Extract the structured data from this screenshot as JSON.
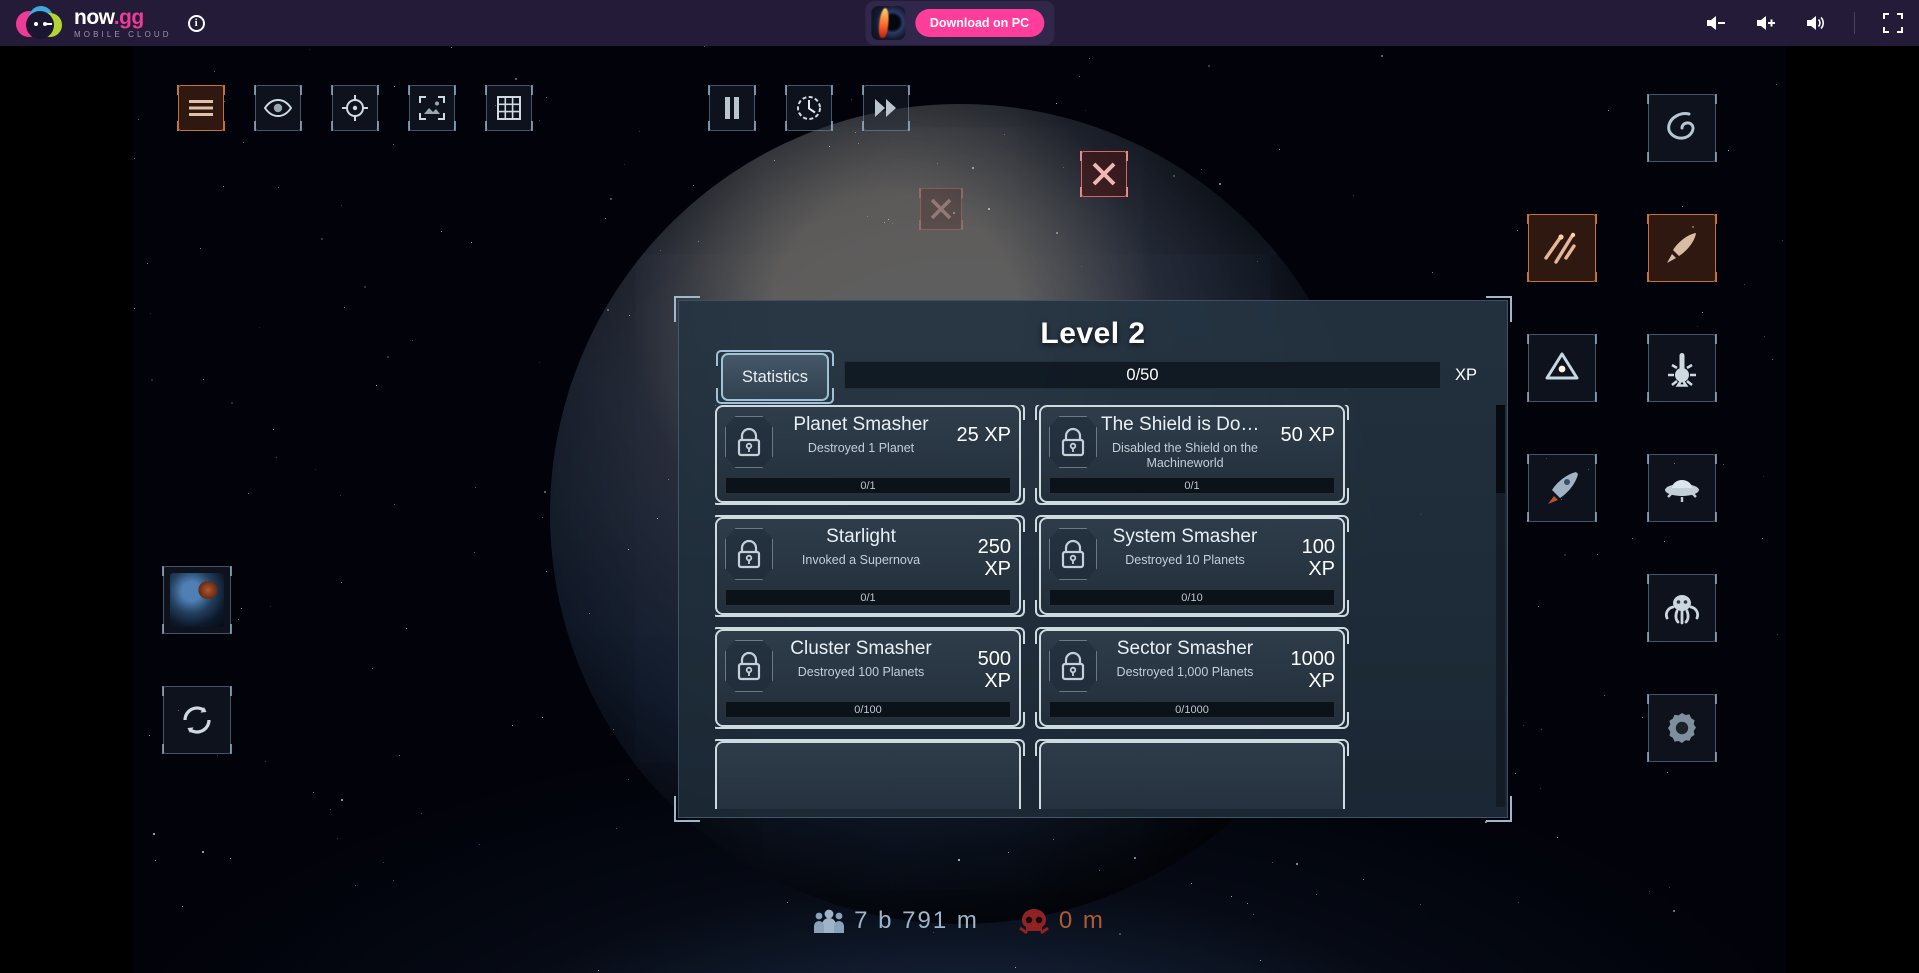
{
  "nowgg_bar": {
    "brand_now": "now",
    "brand_gg": ".gg",
    "brand_sub": "MOBILE CLOUD",
    "info_label": "i",
    "download_label": "Download on PC",
    "icons": {
      "volume_down": "volume-down-icon",
      "volume_up": "volume-up-icon",
      "volume": "volume-icon",
      "fullscreen": "fullscreen-icon"
    }
  },
  "toolbar": {
    "left": [
      {
        "name": "menu-button",
        "active": true
      },
      {
        "name": "visibility-button",
        "active": false
      },
      {
        "name": "target-button",
        "active": false
      },
      {
        "name": "screenshot-button",
        "active": false
      },
      {
        "name": "grid-button",
        "active": false
      }
    ],
    "center": [
      {
        "name": "pause-button"
      },
      {
        "name": "normal-speed-button"
      },
      {
        "name": "fast-forward-button"
      }
    ],
    "close_button": "close-button"
  },
  "right_panel": [
    {
      "name": "galaxy-button",
      "accent": false
    },
    {
      "name": "meteor-shower-button",
      "accent": true
    },
    {
      "name": "missile-button",
      "accent": true
    },
    {
      "name": "energy-ring-button",
      "accent": false
    },
    {
      "name": "heat-ray-button",
      "accent": false
    },
    {
      "name": "rocket-button",
      "accent": false
    },
    {
      "name": "ufo-button",
      "accent": false
    },
    {
      "name": "kraken-button",
      "accent": false
    },
    {
      "name": "settings-button",
      "accent": false
    }
  ],
  "left_panel": [
    {
      "name": "planet-thumbnail-button"
    },
    {
      "name": "restart-button"
    }
  ],
  "stats": {
    "population_value": "7 b 791 m",
    "population_icon": "population-icon",
    "deaths_value": "0 m",
    "deaths_icon": "skull-icon",
    "population_color": "#9fb4c8",
    "deaths_color": "#b05a32"
  },
  "modal": {
    "title": "Level 2",
    "tab_label": "Statistics",
    "xp_progress_text": "0/50",
    "xp_label": "XP",
    "xp_percent": 0,
    "achievements": [
      {
        "name": "Planet Smasher",
        "desc": "Destroyed 1 Planet",
        "xp": "25 XP",
        "progress": "0/1",
        "locked": true
      },
      {
        "name": "The Shield is Down!",
        "desc": "Disabled the Shield on the Machineworld",
        "xp": "50 XP",
        "progress": "0/1",
        "locked": true
      },
      {
        "name": "Starlight",
        "desc": "Invoked a Supernova",
        "xp": "250 XP",
        "progress": "0/1",
        "locked": true
      },
      {
        "name": "System Smasher",
        "desc": "Destroyed 10 Planets",
        "xp": "100 XP",
        "progress": "0/10",
        "locked": true
      },
      {
        "name": "Cluster Smasher",
        "desc": "Destroyed 100 Planets",
        "xp": "500 XP",
        "progress": "0/100",
        "locked": true
      },
      {
        "name": "Sector Smasher",
        "desc": "Destroyed 1,000 Planets",
        "xp": "1000 XP",
        "progress": "0/1000",
        "locked": true
      }
    ]
  }
}
